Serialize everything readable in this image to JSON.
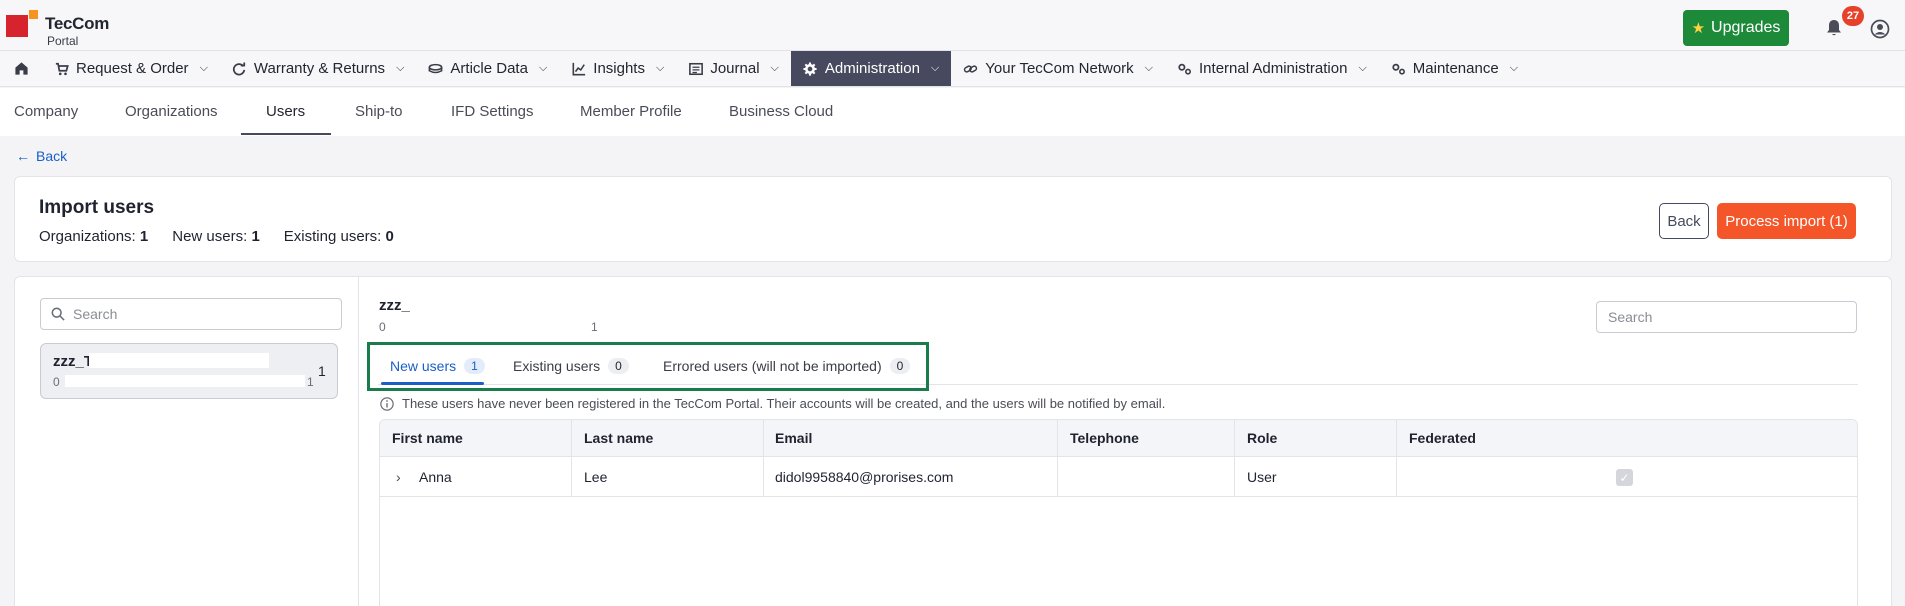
{
  "brand": {
    "name": "TecCom",
    "sub": "Portal"
  },
  "header": {
    "upgrades_label": "Upgrades",
    "notifications_count": "27"
  },
  "nav": {
    "items": [
      {
        "label": "Request & Order",
        "icon": "cart-icon"
      },
      {
        "label": "Warranty & Returns",
        "icon": "refresh-icon"
      },
      {
        "label": "Article Data",
        "icon": "database-icon"
      },
      {
        "label": "Insights",
        "icon": "chart-icon"
      },
      {
        "label": "Journal",
        "icon": "journal-icon"
      },
      {
        "label": "Administration",
        "icon": "gear-icon",
        "active": true
      },
      {
        "label": "Your TecCom Network",
        "icon": "link-icon"
      },
      {
        "label": "Internal Administration",
        "icon": "gears-icon"
      },
      {
        "label": "Maintenance",
        "icon": "gears-icon"
      }
    ]
  },
  "subtabs": {
    "company": "Company",
    "organizations": "Organizations",
    "users": "Users",
    "shipto": "Ship-to",
    "ifd": "IFD Settings",
    "member": "Member Profile",
    "cloud": "Business Cloud",
    "active": "Users"
  },
  "back_link": "Back",
  "import": {
    "title": "Import users",
    "organizations_label": "Organizations:",
    "organizations_value": "1",
    "new_label": "New users:",
    "new_value": "1",
    "existing_label": "Existing users:",
    "existing_value": "0",
    "back_button": "Back",
    "process_button": "Process import (1)"
  },
  "sidebar": {
    "search_placeholder": "Search",
    "org": {
      "name": "zzz_T",
      "sub_left": "0",
      "sub_right": "1",
      "count": "1"
    }
  },
  "detail": {
    "name": "zzz_T",
    "sub_left": "0",
    "sub_right": "1",
    "search_placeholder": "Search",
    "tabs": [
      {
        "label": "New users",
        "count": "1",
        "active": true
      },
      {
        "label": "Existing users",
        "count": "0"
      },
      {
        "label": "Errored users (will not be imported)",
        "count": "0"
      }
    ],
    "info": "These users have never been registered in the TecCom Portal. Their accounts will be created, and the users will be notified by email."
  },
  "table": {
    "columns": [
      "First name",
      "Last name",
      "Email",
      "Telephone",
      "Role",
      "Federated"
    ],
    "rows": [
      {
        "first": "Anna",
        "last": "Lee",
        "email": "didol9958840@prorises.com",
        "phone": "",
        "role": "User",
        "federated": true
      }
    ]
  },
  "colors": {
    "accent_blue": "#1a5fc7",
    "process_orange": "#f4562a",
    "upgrade_green": "#1d8a3a",
    "nav_active": "#474a5e",
    "highlight_green": "#1a7b4d"
  }
}
